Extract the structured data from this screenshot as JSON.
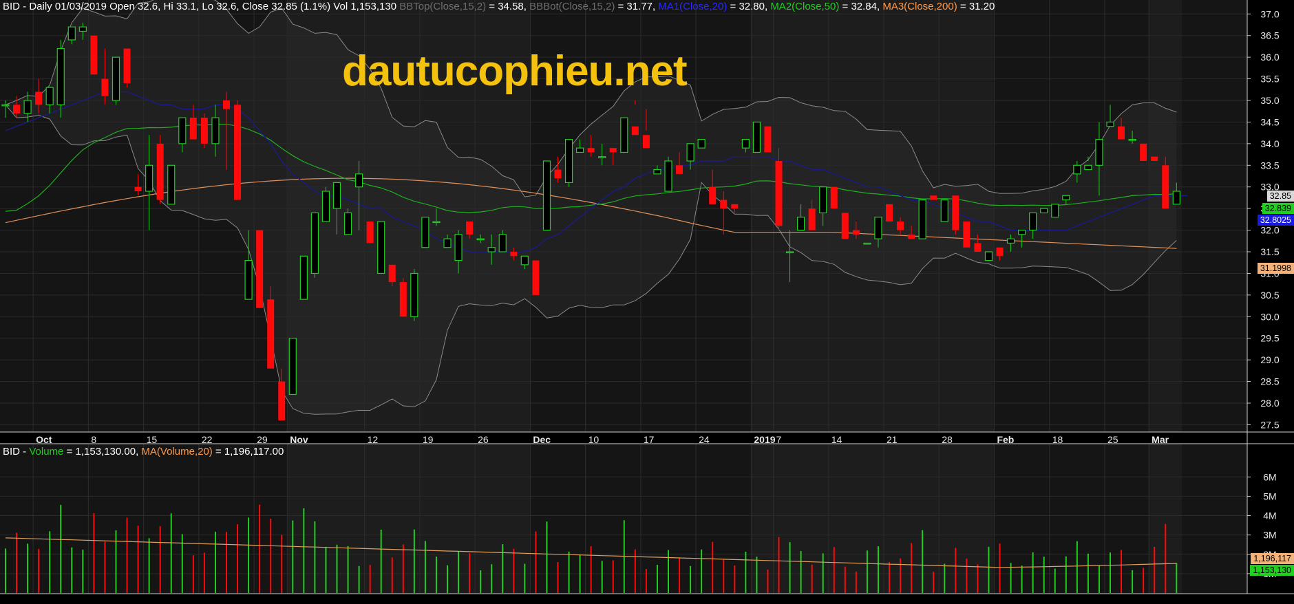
{
  "price_header": {
    "symbol": "BID",
    "desc": " - Daily 01/03/2019 Open 32.6, Hi 33.1, Lo 32.6, Close 32.85 (1.1%) Vol 1,153,130 ",
    "bbtop_label": "BBTop(Close,15,2)",
    "bbtop_value": " = 34.58, ",
    "bbbot_label": "BBBot(Close,15,2)",
    "bbbot_value": " = 31.77, ",
    "ma1_label": "MA1(Close,20)",
    "ma1_value": " = 32.80, ",
    "ma2_label": "MA2(Close,50)",
    "ma2_value": " = 32.84, ",
    "ma3_label": "MA3(Close,200)",
    "ma3_value": " = 31.20"
  },
  "volume_header": {
    "symbol": "BID",
    "dash": " - ",
    "vol_label": "Volume",
    "vol_value": " = 1,153,130.00, ",
    "ma_label": "MA(Volume,20)",
    "ma_value": " = 1,196,117.00"
  },
  "watermark": "dautucophieu.net",
  "last_labels": {
    "close": "32.85",
    "ma2": "32.839",
    "ma1": "32.8025",
    "ma3": "31.1998",
    "vol_ma": "1,196,117",
    "vol": "1,153,130"
  },
  "colors": {
    "up": "#1fd01f",
    "down": "#ff0a0a",
    "ma1": "#1a1a8c",
    "ma2": "#1fb01f",
    "ma3": "#e0905a",
    "bb": "#8a8a8a",
    "vol_ma": "#e0a060",
    "watermark": "#f4c20d"
  },
  "chart_data": [
    {
      "type": "candlestick",
      "ylim": [
        27.3,
        37.1
      ],
      "y_ticks": [
        "27.5",
        "28.0",
        "28.5",
        "29.0",
        "29.5",
        "30.0",
        "30.5",
        "31.0",
        "31.5",
        "32.0",
        "32.5",
        "33.0",
        "33.5",
        "34.0",
        "34.5",
        "35.0",
        "35.5",
        "36.0",
        "36.5",
        "37.0"
      ],
      "x_labels": [
        {
          "i": 3,
          "t": "Oct",
          "bold": true
        },
        {
          "i": 8,
          "t": "8"
        },
        {
          "i": 13,
          "t": "15"
        },
        {
          "i": 18,
          "t": "22"
        },
        {
          "i": 23,
          "t": "29"
        },
        {
          "i": 26,
          "t": "Nov",
          "bold": true
        },
        {
          "i": 33,
          "t": "12"
        },
        {
          "i": 38,
          "t": "19"
        },
        {
          "i": 43,
          "t": "26"
        },
        {
          "i": 48,
          "t": "Dec",
          "bold": true
        },
        {
          "i": 53,
          "t": "10"
        },
        {
          "i": 58,
          "t": "17"
        },
        {
          "i": 63,
          "t": "24"
        },
        {
          "i": 68,
          "t": "2019",
          "bold": true
        },
        {
          "i": 70,
          "t": "7"
        },
        {
          "i": 75,
          "t": "14"
        },
        {
          "i": 80,
          "t": "21"
        },
        {
          "i": 85,
          "t": "28"
        },
        {
          "i": 90,
          "t": "Feb",
          "bold": true
        },
        {
          "i": 95,
          "t": "18"
        },
        {
          "i": 100,
          "t": "25"
        },
        {
          "i": 104,
          "t": "Mar",
          "bold": true
        }
      ],
      "ohlc": [
        [
          34.9,
          35.0,
          34.6,
          34.9
        ],
        [
          34.9,
          35.1,
          34.6,
          34.7
        ],
        [
          34.7,
          35.2,
          34.5,
          35.0
        ],
        [
          35.2,
          35.5,
          34.7,
          34.9
        ],
        [
          34.9,
          35.3,
          34.7,
          35.3
        ],
        [
          34.9,
          36.4,
          34.6,
          36.2
        ],
        [
          36.4,
          36.7,
          36.3,
          36.7
        ],
        [
          36.6,
          36.8,
          36.4,
          36.7
        ],
        [
          36.5,
          36.5,
          35.6,
          35.6
        ],
        [
          35.5,
          36.2,
          34.9,
          35.1
        ],
        [
          35.0,
          35.8,
          34.9,
          36.0
        ],
        [
          36.2,
          36.2,
          35.3,
          35.4
        ],
        [
          33.0,
          33.3,
          32.8,
          32.9
        ],
        [
          32.9,
          34.2,
          32.0,
          33.5
        ],
        [
          34.0,
          34.2,
          32.6,
          32.7
        ],
        [
          32.6,
          33.4,
          32.6,
          33.5
        ],
        [
          34.0,
          34.5,
          33.8,
          34.6
        ],
        [
          34.6,
          34.9,
          34.5,
          34.1
        ],
        [
          34.6,
          34.7,
          33.9,
          34.0
        ],
        [
          34.0,
          34.9,
          33.7,
          34.6
        ],
        [
          35.0,
          35.2,
          33.4,
          34.8
        ],
        [
          34.9,
          35.0,
          32.7,
          32.7
        ],
        [
          30.4,
          32.0,
          30.4,
          31.3
        ],
        [
          32.0,
          32.0,
          30.2,
          30.2
        ],
        [
          30.4,
          30.7,
          29.0,
          28.8
        ],
        [
          28.5,
          28.8,
          27.6,
          27.6
        ],
        [
          28.2,
          29.5,
          28.2,
          29.5
        ],
        [
          30.4,
          31.4,
          30.4,
          31.4
        ],
        [
          31.0,
          32.3,
          30.9,
          32.4
        ],
        [
          32.2,
          33.0,
          32.3,
          32.9
        ],
        [
          32.5,
          33.0,
          31.9,
          33.1
        ],
        [
          31.9,
          32.5,
          32.0,
          32.4
        ],
        [
          33.0,
          33.6,
          32.0,
          33.3
        ],
        [
          32.2,
          32.2,
          31.7,
          31.7
        ],
        [
          31.0,
          32.1,
          31.0,
          32.2
        ],
        [
          31.2,
          31.2,
          30.7,
          30.8
        ],
        [
          30.8,
          30.9,
          30.0,
          30.0
        ],
        [
          30.0,
          31.1,
          29.9,
          31.0
        ],
        [
          31.6,
          32.2,
          31.7,
          32.3
        ],
        [
          32.2,
          32.5,
          32.1,
          32.2
        ],
        [
          31.6,
          31.9,
          31.6,
          31.8
        ],
        [
          31.3,
          32.0,
          31.0,
          31.9
        ],
        [
          32.2,
          32.2,
          31.8,
          31.9
        ],
        [
          31.8,
          31.9,
          31.7,
          31.8
        ],
        [
          31.5,
          31.9,
          31.2,
          31.6
        ],
        [
          31.5,
          32.0,
          31.5,
          31.9
        ],
        [
          31.5,
          31.6,
          31.3,
          31.4
        ],
        [
          31.2,
          31.3,
          31.1,
          31.4
        ],
        [
          31.3,
          31.3,
          30.6,
          30.5
        ],
        [
          32.0,
          33.6,
          32.0,
          33.6
        ],
        [
          33.4,
          33.7,
          33.1,
          33.2
        ],
        [
          33.1,
          34.1,
          33.0,
          34.1
        ],
        [
          33.8,
          34.1,
          33.8,
          33.9
        ],
        [
          33.9,
          34.2,
          33.7,
          33.8
        ],
        [
          33.7,
          34.0,
          33.5,
          33.7
        ],
        [
          33.9,
          33.9,
          33.5,
          33.8
        ],
        [
          33.8,
          34.6,
          33.8,
          34.6
        ],
        [
          34.4,
          35.0,
          34.9,
          34.2
        ],
        [
          34.2,
          34.8,
          34.3,
          33.9
        ],
        [
          33.3,
          33.5,
          33.4,
          33.4
        ],
        [
          32.9,
          33.7,
          32.9,
          33.6
        ],
        [
          33.5,
          33.8,
          33.4,
          33.3
        ],
        [
          33.6,
          34.0,
          33.4,
          34.0
        ],
        [
          33.9,
          34.1,
          33.9,
          34.1
        ],
        [
          33.0,
          33.4,
          32.8,
          32.6
        ],
        [
          32.7,
          32.9,
          31.9,
          32.5
        ],
        [
          32.6,
          32.6,
          32.4,
          32.5
        ],
        [
          33.9,
          34.1,
          33.8,
          34.1
        ],
        [
          33.8,
          34.5,
          33.8,
          34.5
        ],
        [
          34.4,
          34.4,
          33.9,
          33.8
        ],
        [
          33.6,
          33.9,
          32.0,
          32.1
        ],
        [
          31.5,
          32.0,
          30.8,
          31.5
        ],
        [
          32.0,
          32.6,
          32.0,
          32.3
        ],
        [
          32.5,
          32.7,
          32.2,
          32.0
        ],
        [
          32.4,
          33.0,
          32.1,
          33.0
        ],
        [
          33.0,
          33.0,
          32.5,
          32.5
        ],
        [
          32.4,
          32.4,
          31.8,
          31.8
        ],
        [
          32.0,
          32.2,
          31.8,
          31.9
        ],
        [
          31.7,
          31.7,
          31.7,
          31.7
        ],
        [
          31.8,
          32.2,
          31.6,
          32.3
        ],
        [
          32.6,
          32.6,
          32.2,
          32.2
        ],
        [
          32.2,
          32.3,
          31.9,
          32.0
        ],
        [
          31.9,
          32.1,
          31.8,
          31.8
        ],
        [
          31.8,
          32.7,
          31.8,
          32.7
        ],
        [
          32.8,
          32.8,
          32.7,
          32.7
        ],
        [
          32.2,
          32.7,
          32.2,
          32.7
        ],
        [
          32.8,
          32.8,
          31.9,
          32.0
        ],
        [
          32.2,
          32.2,
          31.7,
          31.6
        ],
        [
          31.7,
          31.9,
          31.5,
          31.5
        ],
        [
          31.3,
          31.4,
          31.4,
          31.5
        ],
        [
          31.6,
          31.6,
          31.3,
          31.4
        ],
        [
          31.7,
          31.9,
          31.5,
          31.8
        ],
        [
          31.9,
          32.0,
          31.6,
          32.0
        ],
        [
          32.0,
          32.4,
          31.8,
          32.4
        ],
        [
          32.4,
          32.4,
          32.4,
          32.5
        ],
        [
          32.3,
          32.3,
          32.3,
          32.6
        ],
        [
          32.7,
          32.8,
          32.6,
          32.8
        ],
        [
          33.3,
          33.6,
          33.1,
          33.5
        ],
        [
          33.4,
          33.7,
          33.6,
          33.5
        ],
        [
          33.5,
          34.5,
          32.8,
          34.1
        ],
        [
          34.4,
          34.9,
          34.4,
          34.5
        ],
        [
          34.4,
          34.6,
          34.4,
          34.1
        ],
        [
          34.1,
          34.3,
          34.0,
          34.1
        ],
        [
          34.0,
          34.0,
          33.6,
          33.6
        ],
        [
          33.7,
          33.7,
          33.6,
          33.6
        ],
        [
          33.5,
          33.7,
          32.7,
          32.5
        ],
        [
          32.6,
          33.1,
          32.6,
          32.9
        ]
      ],
      "ma1": [
        34.3,
        34.4,
        34.5,
        34.6,
        34.7,
        34.8,
        34.9,
        35.0,
        35.1,
        35.2,
        35.2,
        35.2,
        35.1,
        35.0,
        34.9,
        34.9,
        34.8,
        34.8,
        34.8,
        34.9,
        34.9,
        34.8,
        34.6,
        34.3,
        34.0,
        33.6,
        33.3,
        33.1,
        32.9,
        32.8,
        32.8,
        32.7,
        32.6,
        32.5,
        32.5,
        32.3,
        32.2,
        32.1,
        32.0,
        31.8,
        31.7,
        31.6,
        31.5,
        31.5,
        31.5,
        31.5,
        31.5,
        31.5,
        31.6,
        31.8,
        31.9,
        32.1,
        32.3,
        32.5,
        32.7,
        32.9,
        33.0,
        33.2,
        33.3,
        33.4,
        33.4,
        33.5,
        33.5,
        33.6,
        33.6,
        33.6,
        33.7,
        33.7,
        33.7,
        33.7,
        33.6,
        33.6,
        33.5,
        33.4,
        33.4,
        33.3,
        33.2,
        33.1,
        33.0,
        33.0,
        32.9,
        32.8,
        32.7,
        32.7,
        32.6,
        32.5,
        32.4,
        32.3,
        32.2,
        32.2,
        32.1,
        32.0,
        32.0,
        32.0,
        32.0,
        32.0,
        32.0,
        32.1,
        32.2,
        32.3,
        32.4,
        32.5,
        32.6,
        32.7,
        32.8,
        32.8,
        32.8,
        32.8
      ]
    },
    {
      "type": "bar",
      "ylim": [
        0,
        6.9
      ],
      "y_ticks": [
        "1M",
        "2M",
        "3M",
        "4M",
        "5M",
        "6M"
      ],
      "y_unit": "M"
    }
  ]
}
